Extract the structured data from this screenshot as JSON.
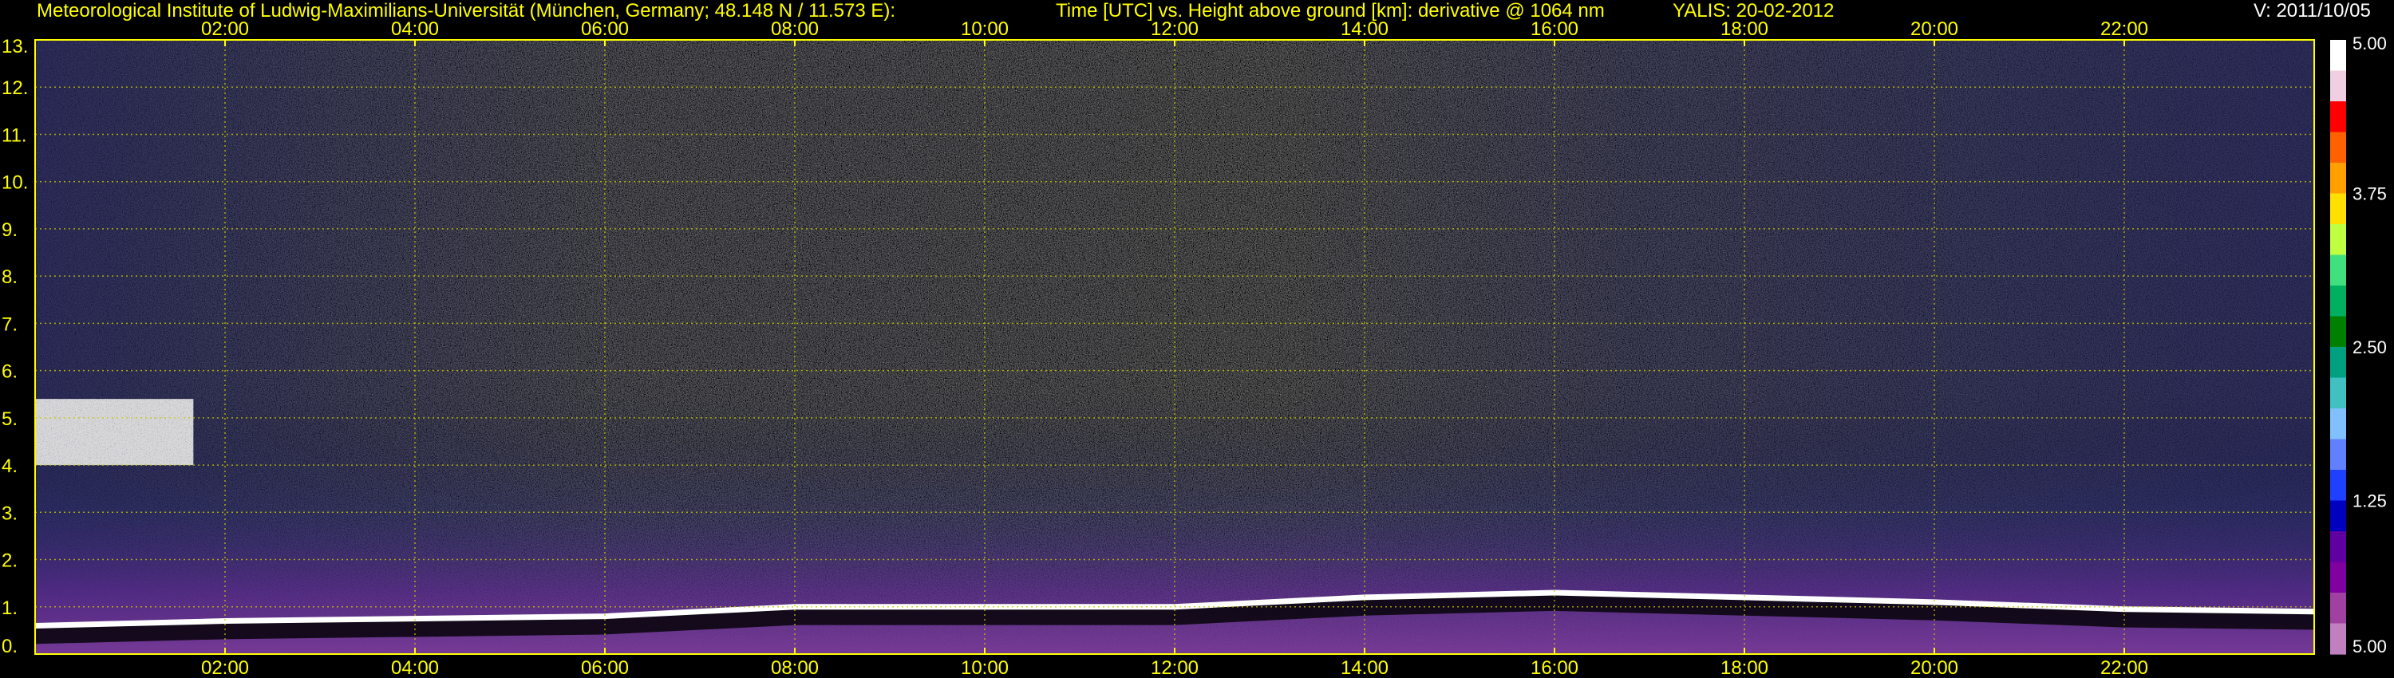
{
  "header": {
    "institute": "Meteorological Institute of Ludwig-Maximilians-Universität (München, Germany; 48.148 N / 11.573 E):",
    "axes_title": "Time [UTC] vs. Height above ground [km]: derivative @ 1064 nm",
    "instrument_date": "YALIS: 20-02-2012",
    "version": "V: 2011/10/05"
  },
  "chart_data": {
    "type": "heatmap",
    "title": "Time [UTC] vs. Height above ground [km]: derivative @ 1064 nm",
    "xlabel": "Time [UTC]",
    "ylabel": "Height above ground [km]",
    "x_ticks": [
      "02:00",
      "04:00",
      "06:00",
      "08:00",
      "10:00",
      "12:00",
      "14:00",
      "16:00",
      "18:00",
      "20:00",
      "22:00"
    ],
    "x_tick_hours": [
      2,
      4,
      6,
      8,
      10,
      12,
      14,
      16,
      18,
      20,
      22
    ],
    "x_range_hours": [
      0,
      24
    ],
    "y_ticks": [
      "0.",
      "1.",
      "2.",
      "3.",
      "4.",
      "5.",
      "6.",
      "7.",
      "8.",
      "9.",
      "10.",
      "11.",
      "12.",
      "13."
    ],
    "y_range_km": [
      0,
      13
    ],
    "grid": true,
    "colorbar": {
      "tick_labels": [
        "5.00",
        "3.75",
        "2.50",
        "1.25",
        "5.00"
      ],
      "tick_values": [
        5.0,
        3.75,
        2.5,
        1.25,
        0
      ],
      "colors": [
        "#ffffff",
        "#f0d0e0",
        "#ff0000",
        "#ff6000",
        "#ffa000",
        "#ffe000",
        "#c0ff40",
        "#40e080",
        "#00b060",
        "#008000",
        "#00a080",
        "#40c0c0",
        "#80c0ff",
        "#6080ff",
        "#2040ff",
        "#0000c0",
        "#6000a0",
        "#8000a0",
        "#a040a0",
        "#c080c0"
      ]
    },
    "features": [
      {
        "label": "cloud layer",
        "start": "00:00",
        "end": "01:40",
        "bottom_km": 4.0,
        "top_km": 5.4
      },
      {
        "label": "boundary layer top",
        "points": [
          [
            "00:00",
            0.6
          ],
          [
            "02:00",
            0.7
          ],
          [
            "06:00",
            0.8
          ],
          [
            "08:00",
            1.0
          ],
          [
            "10:00",
            1.0
          ],
          [
            "12:00",
            1.0
          ],
          [
            "14:00",
            1.2
          ],
          [
            "16:00",
            1.3
          ],
          [
            "18:00",
            1.2
          ],
          [
            "20:00",
            1.1
          ],
          [
            "22:00",
            0.95
          ],
          [
            "24:00",
            0.9
          ]
        ]
      }
    ]
  }
}
